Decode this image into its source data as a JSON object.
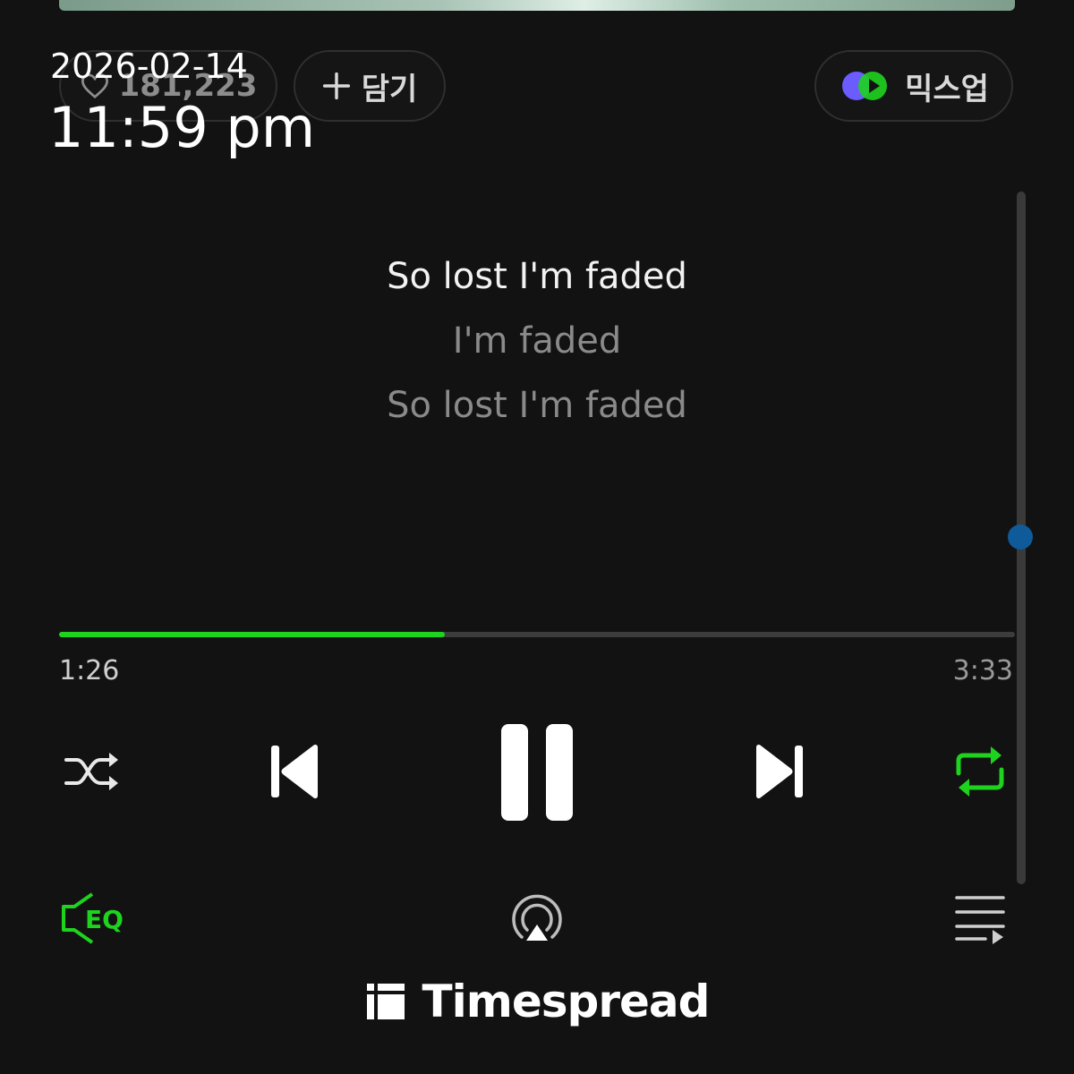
{
  "overlay": {
    "date": "2026-02-14",
    "time": "11:59 pm"
  },
  "actions": {
    "like_count": "181,223",
    "add_label": "담기",
    "mixup_label": "믹스업"
  },
  "lyrics": {
    "lines": [
      "So lost I'm faded",
      "I'm faded",
      "So lost I'm faded"
    ],
    "current_index": 0
  },
  "playback": {
    "elapsed": "1:26",
    "total": "3:33",
    "progress_percent": 40.4,
    "state": "playing",
    "shuffle": false,
    "repeat": true
  },
  "icons": {
    "heart": "heart-icon",
    "plus": "plus-icon",
    "mixup": "mixup-icon",
    "shuffle": "shuffle-icon",
    "previous": "skip-previous-icon",
    "pause": "pause-icon",
    "next": "skip-next-icon",
    "repeat": "repeat-icon",
    "eq": "eq-icon",
    "airplay": "airplay-icon",
    "playlist": "playlist-icon"
  },
  "watermark": {
    "brand": "Timespread"
  },
  "colors": {
    "accent": "#1ed31e",
    "background": "#121212",
    "scroll_thumb": "#0f5b9a"
  }
}
